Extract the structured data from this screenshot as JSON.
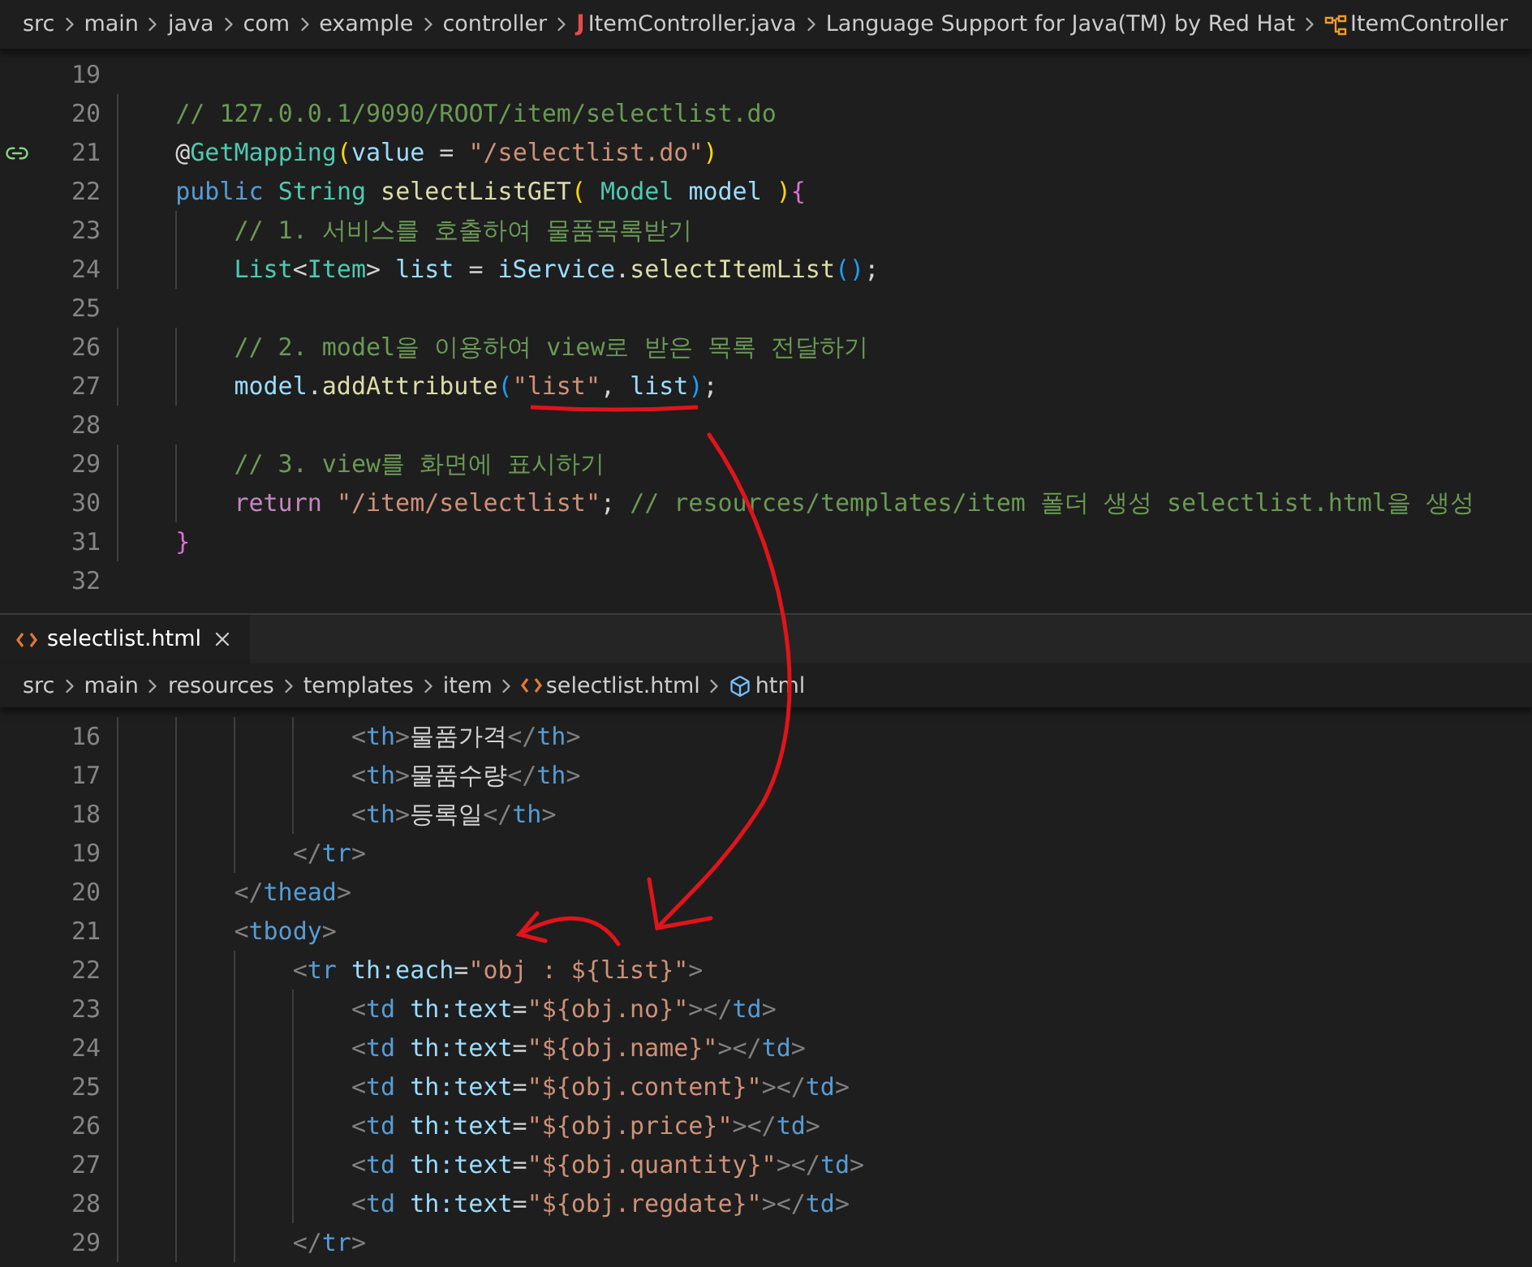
{
  "top_breadcrumb": [
    {
      "label": "src",
      "kind": "folder"
    },
    {
      "label": "main",
      "kind": "folder"
    },
    {
      "label": "java",
      "kind": "folder"
    },
    {
      "label": "com",
      "kind": "folder"
    },
    {
      "label": "example",
      "kind": "folder"
    },
    {
      "label": "controller",
      "kind": "folder"
    },
    {
      "label": "ItemController.java",
      "kind": "java",
      "glyph": "J"
    },
    {
      "label": "Language Support for Java(TM) by Red Hat",
      "kind": "folder"
    },
    {
      "label": "ItemController",
      "kind": "class"
    }
  ],
  "java_editor": {
    "lines": [
      {
        "number": "19",
        "marker": false
      },
      {
        "number": "20",
        "marker": false,
        "tokens": [
          {
            "text": "    // 127.0.0.1/9090/ROOT/item/selectlist.do",
            "kind": "comment"
          }
        ]
      },
      {
        "number": "21",
        "marker": true,
        "tokens": [
          {
            "text": "    @",
            "kind": "plain"
          },
          {
            "text": "GetMapping",
            "kind": "type"
          },
          {
            "text": "(",
            "kind": "b1"
          },
          {
            "text": "value",
            "kind": "var"
          },
          {
            "text": " = ",
            "kind": "plain"
          },
          {
            "text": "\"/selectlist.do\"",
            "kind": "string"
          },
          {
            "text": ")",
            "kind": "b1"
          }
        ]
      },
      {
        "number": "22",
        "marker": false,
        "tokens": [
          {
            "text": "    public ",
            "kind": "keyword"
          },
          {
            "text": "String ",
            "kind": "type"
          },
          {
            "text": "selectListGET",
            "kind": "func"
          },
          {
            "text": "( ",
            "kind": "b1"
          },
          {
            "text": "Model ",
            "kind": "type"
          },
          {
            "text": "model ",
            "kind": "var"
          },
          {
            "text": ")",
            "kind": "b1"
          },
          {
            "text": "{",
            "kind": "b2"
          }
        ]
      },
      {
        "number": "23",
        "marker": false,
        "tokens": [
          {
            "text": "        // 1. 서비스를 호출하여 물품목록받기",
            "kind": "comment"
          }
        ]
      },
      {
        "number": "24",
        "marker": false,
        "tokens": [
          {
            "text": "        List",
            "kind": "type"
          },
          {
            "text": "<",
            "kind": "plain"
          },
          {
            "text": "Item",
            "kind": "type"
          },
          {
            "text": "> ",
            "kind": "plain"
          },
          {
            "text": "list",
            "kind": "var"
          },
          {
            "text": " = ",
            "kind": "plain"
          },
          {
            "text": "iService",
            "kind": "var"
          },
          {
            "text": ".",
            "kind": "plain"
          },
          {
            "text": "selectItemList",
            "kind": "func"
          },
          {
            "text": "()",
            "kind": "b3"
          },
          {
            "text": ";",
            "kind": "plain"
          }
        ]
      },
      {
        "number": "25",
        "marker": false
      },
      {
        "number": "26",
        "marker": false,
        "tokens": [
          {
            "text": "        // 2. model을 이용하여 view로 받은 목록 전달하기",
            "kind": "comment"
          }
        ]
      },
      {
        "number": "27",
        "marker": false,
        "tokens": [
          {
            "text": "        model",
            "kind": "var"
          },
          {
            "text": ".",
            "kind": "plain"
          },
          {
            "text": "addAttribute",
            "kind": "func"
          },
          {
            "text": "(",
            "kind": "b3"
          },
          {
            "text": "\"list\"",
            "kind": "string"
          },
          {
            "text": ", ",
            "kind": "plain"
          },
          {
            "text": "list",
            "kind": "var"
          },
          {
            "text": ")",
            "kind": "b3"
          },
          {
            "text": ";",
            "kind": "plain"
          }
        ]
      },
      {
        "number": "28",
        "marker": false
      },
      {
        "number": "29",
        "marker": false,
        "tokens": [
          {
            "text": "        // 3. view를 화면에 표시하기",
            "kind": "comment"
          }
        ]
      },
      {
        "number": "30",
        "marker": false,
        "tokens": [
          {
            "text": "        return ",
            "kind": "control"
          },
          {
            "text": "\"/item/selectlist\"",
            "kind": "string"
          },
          {
            "text": "; ",
            "kind": "plain"
          },
          {
            "text": "// resources/templates/item 폴더 생성 selectlist.html을 생성",
            "kind": "comment"
          }
        ]
      },
      {
        "number": "31",
        "marker": false,
        "tokens": [
          {
            "text": "    }",
            "kind": "b2"
          }
        ]
      },
      {
        "number": "32",
        "marker": false
      }
    ]
  },
  "tab": {
    "label": "selectlist.html",
    "selected": true
  },
  "html_breadcrumb": [
    {
      "label": "src",
      "kind": "folder"
    },
    {
      "label": "main",
      "kind": "folder"
    },
    {
      "label": "resources",
      "kind": "folder"
    },
    {
      "label": "templates",
      "kind": "folder"
    },
    {
      "label": "item",
      "kind": "folder"
    },
    {
      "label": "selectlist.html",
      "kind": "html"
    },
    {
      "label": "html",
      "kind": "element"
    }
  ],
  "html_editor": {
    "lines": [
      {
        "number": "16",
        "tokens": [
          {
            "text": "                <",
            "kind": "punct"
          },
          {
            "text": "th",
            "kind": "tag"
          },
          {
            "text": ">",
            "kind": "punct"
          },
          {
            "text": "물품가격",
            "kind": "plain"
          },
          {
            "text": "</",
            "kind": "punct"
          },
          {
            "text": "th",
            "kind": "tag"
          },
          {
            "text": ">",
            "kind": "punct"
          }
        ]
      },
      {
        "number": "17",
        "tokens": [
          {
            "text": "                <",
            "kind": "punct"
          },
          {
            "text": "th",
            "kind": "tag"
          },
          {
            "text": ">",
            "kind": "punct"
          },
          {
            "text": "물품수량",
            "kind": "plain"
          },
          {
            "text": "</",
            "kind": "punct"
          },
          {
            "text": "th",
            "kind": "tag"
          },
          {
            "text": ">",
            "kind": "punct"
          }
        ]
      },
      {
        "number": "18",
        "tokens": [
          {
            "text": "                <",
            "kind": "punct"
          },
          {
            "text": "th",
            "kind": "tag"
          },
          {
            "text": ">",
            "kind": "punct"
          },
          {
            "text": "등록일",
            "kind": "plain"
          },
          {
            "text": "</",
            "kind": "punct"
          },
          {
            "text": "th",
            "kind": "tag"
          },
          {
            "text": ">",
            "kind": "punct"
          }
        ]
      },
      {
        "number": "19",
        "tokens": [
          {
            "text": "            </",
            "kind": "punct"
          },
          {
            "text": "tr",
            "kind": "tag"
          },
          {
            "text": ">",
            "kind": "punct"
          }
        ]
      },
      {
        "number": "20",
        "tokens": [
          {
            "text": "        </",
            "kind": "punct"
          },
          {
            "text": "thead",
            "kind": "tag"
          },
          {
            "text": ">",
            "kind": "punct"
          }
        ]
      },
      {
        "number": "21",
        "tokens": [
          {
            "text": "        <",
            "kind": "punct"
          },
          {
            "text": "tbody",
            "kind": "tag"
          },
          {
            "text": ">",
            "kind": "punct"
          }
        ]
      },
      {
        "number": "22",
        "tokens": [
          {
            "text": "            <",
            "kind": "punct"
          },
          {
            "text": "tr ",
            "kind": "tag"
          },
          {
            "text": "th:each",
            "kind": "attr"
          },
          {
            "text": "=",
            "kind": "plain"
          },
          {
            "text": "\"obj : ${list}\"",
            "kind": "string"
          },
          {
            "text": ">",
            "kind": "punct"
          }
        ]
      },
      {
        "number": "23",
        "tokens": [
          {
            "text": "                <",
            "kind": "punct"
          },
          {
            "text": "td ",
            "kind": "tag"
          },
          {
            "text": "th:text",
            "kind": "attr"
          },
          {
            "text": "=",
            "kind": "plain"
          },
          {
            "text": "\"${obj.no}\"",
            "kind": "string"
          },
          {
            "text": "></",
            "kind": "punct"
          },
          {
            "text": "td",
            "kind": "tag"
          },
          {
            "text": ">",
            "kind": "punct"
          }
        ]
      },
      {
        "number": "24",
        "tokens": [
          {
            "text": "                <",
            "kind": "punct"
          },
          {
            "text": "td ",
            "kind": "tag"
          },
          {
            "text": "th:text",
            "kind": "attr"
          },
          {
            "text": "=",
            "kind": "plain"
          },
          {
            "text": "\"${obj.name}\"",
            "kind": "string"
          },
          {
            "text": "></",
            "kind": "punct"
          },
          {
            "text": "td",
            "kind": "tag"
          },
          {
            "text": ">",
            "kind": "punct"
          }
        ]
      },
      {
        "number": "25",
        "tokens": [
          {
            "text": "                <",
            "kind": "punct"
          },
          {
            "text": "td ",
            "kind": "tag"
          },
          {
            "text": "th:text",
            "kind": "attr"
          },
          {
            "text": "=",
            "kind": "plain"
          },
          {
            "text": "\"${obj.content}\"",
            "kind": "string"
          },
          {
            "text": "></",
            "kind": "punct"
          },
          {
            "text": "td",
            "kind": "tag"
          },
          {
            "text": ">",
            "kind": "punct"
          }
        ]
      },
      {
        "number": "26",
        "tokens": [
          {
            "text": "                <",
            "kind": "punct"
          },
          {
            "text": "td ",
            "kind": "tag"
          },
          {
            "text": "th:text",
            "kind": "attr"
          },
          {
            "text": "=",
            "kind": "plain"
          },
          {
            "text": "\"${obj.price}\"",
            "kind": "string"
          },
          {
            "text": "></",
            "kind": "punct"
          },
          {
            "text": "td",
            "kind": "tag"
          },
          {
            "text": ">",
            "kind": "punct"
          }
        ]
      },
      {
        "number": "27",
        "tokens": [
          {
            "text": "                <",
            "kind": "punct"
          },
          {
            "text": "td ",
            "kind": "tag"
          },
          {
            "text": "th:text",
            "kind": "attr"
          },
          {
            "text": "=",
            "kind": "plain"
          },
          {
            "text": "\"${obj.quantity}\"",
            "kind": "string"
          },
          {
            "text": "></",
            "kind": "punct"
          },
          {
            "text": "td",
            "kind": "tag"
          },
          {
            "text": ">",
            "kind": "punct"
          }
        ]
      },
      {
        "number": "28",
        "tokens": [
          {
            "text": "                <",
            "kind": "punct"
          },
          {
            "text": "td ",
            "kind": "tag"
          },
          {
            "text": "th:text",
            "kind": "attr"
          },
          {
            "text": "=",
            "kind": "plain"
          },
          {
            "text": "\"${obj.regdate}\"",
            "kind": "string"
          },
          {
            "text": "></",
            "kind": "punct"
          },
          {
            "text": "td",
            "kind": "tag"
          },
          {
            "text": ">",
            "kind": "punct"
          }
        ]
      },
      {
        "number": "29",
        "tokens": [
          {
            "text": "            </",
            "kind": "punct"
          },
          {
            "text": "tr",
            "kind": "tag"
          },
          {
            "text": ">",
            "kind": "punct"
          }
        ]
      }
    ]
  }
}
